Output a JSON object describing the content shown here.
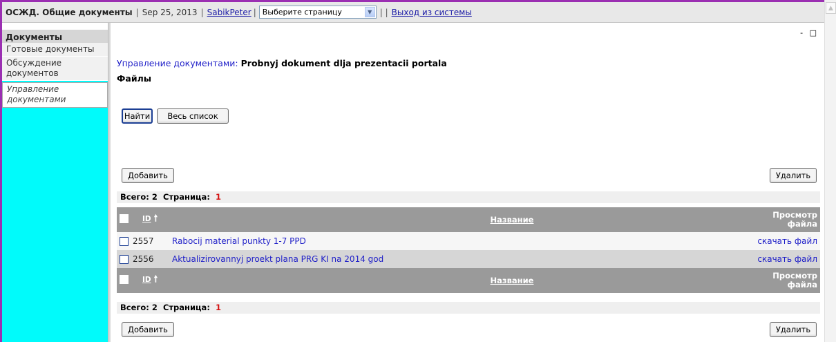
{
  "header": {
    "site_title": "ОСЖД. Общие документы",
    "separator": "|",
    "date": "Sep 25, 2013",
    "user": "SabikPeter",
    "page_select": {
      "value": "Выберите страницу"
    },
    "separator2": "| |",
    "logout": "Выход из системы"
  },
  "sidebar": {
    "heading": "Документы",
    "items": [
      {
        "label": "Готовые документы",
        "active": false
      },
      {
        "label": "Обсуждение документов",
        "active": false
      },
      {
        "label": "Управление документами",
        "active": true
      }
    ]
  },
  "window_controls": "- □",
  "breadcrumb": {
    "section": "Управление документами:",
    "document": "Probnyj dokument dlja prezentacii portala"
  },
  "subtitle": "Файлы",
  "buttons": {
    "find": "Найти",
    "full_list": "Весь список",
    "add": "Добавить",
    "delete": "Удалить"
  },
  "summary": {
    "total_label": "Всего:",
    "total": "2",
    "page_label": "Страница:",
    "page": "1"
  },
  "table": {
    "columns": {
      "id": "ID",
      "sort_icon": "arrow-up",
      "name": "Название",
      "view": "Просмотр файла"
    },
    "rows": [
      {
        "id": "2557",
        "name": "Rabocij material punkty 1-7 PPD",
        "view": "скачать файл"
      },
      {
        "id": "2556",
        "name": "Aktualizirovannyj proekt plana PRG KI na 2014 god",
        "view": "скачать файл"
      }
    ]
  },
  "colors": {
    "frame": "#9b2fb2",
    "sidebar": "#00fbfb",
    "table_header": "#9a9a9a",
    "link": "#1f1fc8",
    "count": "#d41111"
  }
}
